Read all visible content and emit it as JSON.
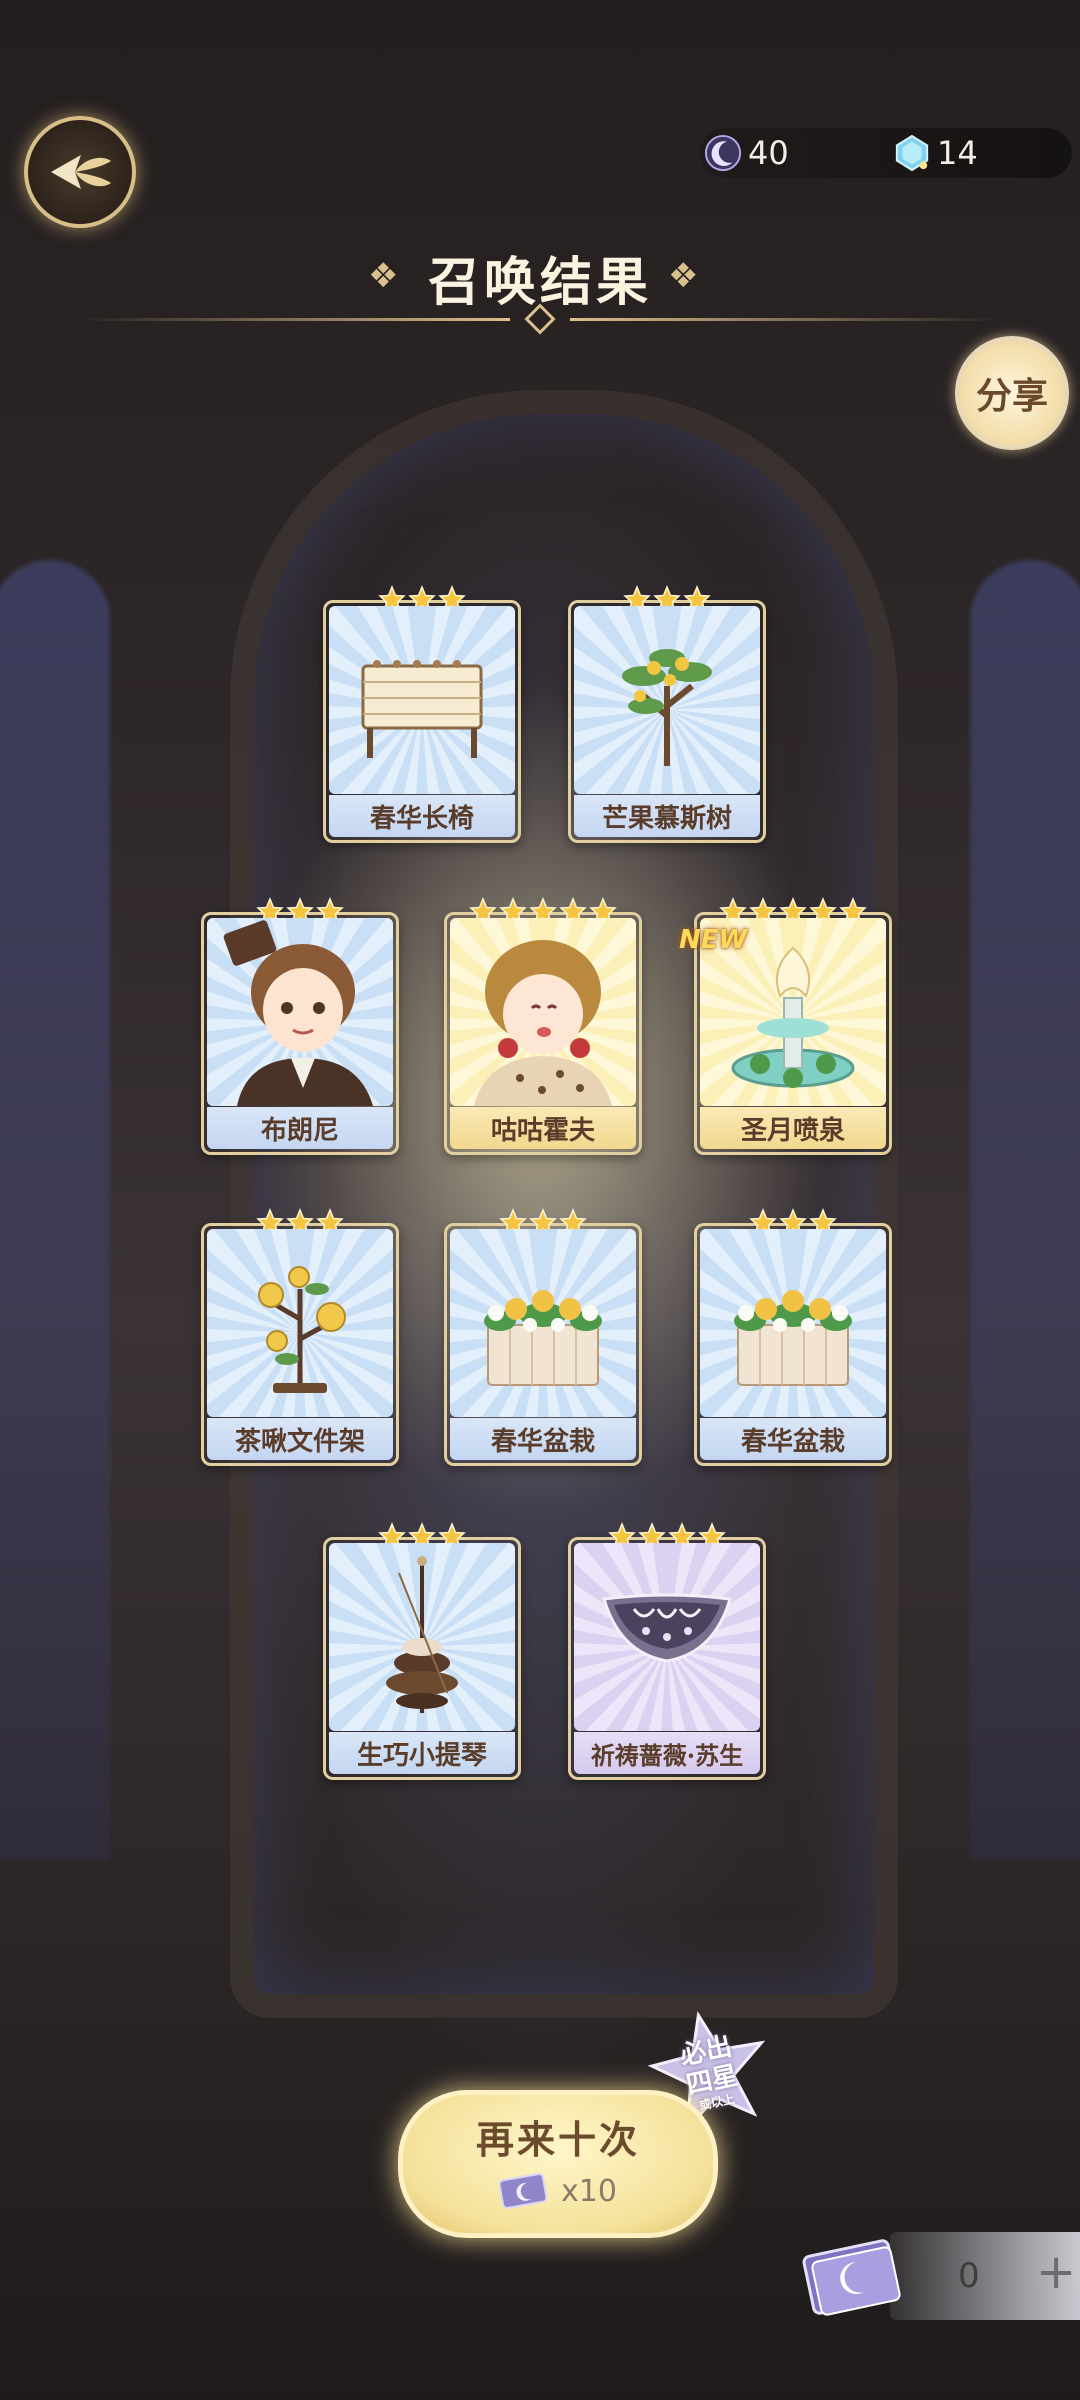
{
  "header": {
    "title": "召唤结果",
    "share_label": "分享"
  },
  "currency": {
    "moon": {
      "value": "40",
      "icon": "crescent-moon-icon"
    },
    "crystal": {
      "value": "14",
      "icon": "crystal-icon"
    }
  },
  "cards": [
    {
      "name": "春华长椅",
      "stars": 3,
      "rarity": "blue",
      "is_new": false,
      "icon": "bench-icon"
    },
    {
      "name": "芒果慕斯树",
      "stars": 3,
      "rarity": "blue",
      "is_new": false,
      "icon": "mango-tree-icon"
    },
    {
      "name": "布朗尼",
      "stars": 3,
      "rarity": "blue",
      "is_new": false,
      "icon": "boy-character-icon"
    },
    {
      "name": "咕咕霍夫",
      "stars": 5,
      "rarity": "gold",
      "is_new": false,
      "icon": "girl-character-icon"
    },
    {
      "name": "圣月喷泉",
      "stars": 5,
      "rarity": "gold",
      "is_new": true,
      "new_label": "NEW",
      "icon": "fountain-icon"
    },
    {
      "name": "茶啾文件架",
      "stars": 3,
      "rarity": "blue",
      "is_new": false,
      "icon": "file-rack-icon"
    },
    {
      "name": "春华盆栽",
      "stars": 3,
      "rarity": "blue",
      "is_new": false,
      "icon": "planter-icon"
    },
    {
      "name": "春华盆栽",
      "stars": 3,
      "rarity": "blue",
      "is_new": false,
      "icon": "planter-icon"
    },
    {
      "name": "生巧小提琴",
      "stars": 3,
      "rarity": "blue",
      "is_new": false,
      "icon": "violin-icon"
    },
    {
      "name": "祈祷蔷薇·苏生",
      "stars": 4,
      "rarity": "purple",
      "is_new": false,
      "icon": "crown-headpiece-icon"
    }
  ],
  "summon_again": {
    "label": "再来十次",
    "cost": "x10",
    "badge_line1": "必出",
    "badge_line2": "四星",
    "badge_sub": "或以上"
  },
  "tickets": {
    "count": "0",
    "plus": "+"
  },
  "colors": {
    "accent_gold": "#d9c08c",
    "star": "#f5c542",
    "text_brown": "#5a3c2a"
  }
}
